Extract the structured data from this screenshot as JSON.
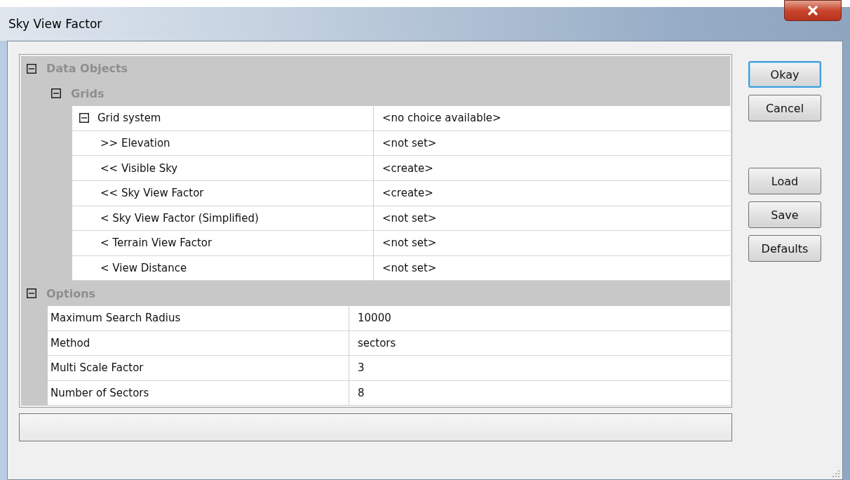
{
  "window": {
    "title": "Sky View Factor"
  },
  "properties": [
    {
      "kind": "category",
      "label": "Data Objects",
      "expanded": true,
      "children": [
        {
          "kind": "category",
          "label": "Grids",
          "expanded": true,
          "children": [
            {
              "kind": "property",
              "label": "Grid system",
              "value": "<no choice available>",
              "expanded": true,
              "children": [
                {
                  "kind": "property",
                  "label": ">> Elevation",
                  "value": "<not set>"
                },
                {
                  "kind": "property",
                  "label": "<< Visible Sky",
                  "value": "<create>"
                },
                {
                  "kind": "property",
                  "label": "<< Sky View Factor",
                  "value": "<create>"
                },
                {
                  "kind": "property",
                  "label": "< Sky View Factor (Simplified)",
                  "value": "<not set>"
                },
                {
                  "kind": "property",
                  "label": "< Terrain View Factor",
                  "value": "<not set>"
                },
                {
                  "kind": "property",
                  "label": "< View Distance",
                  "value": "<not set>"
                }
              ]
            }
          ]
        }
      ]
    },
    {
      "kind": "category",
      "label": "Options",
      "expanded": true,
      "children": [
        {
          "kind": "property",
          "label": "Maximum Search Radius",
          "value": "10000"
        },
        {
          "kind": "property",
          "label": "Method",
          "value": "sectors"
        },
        {
          "kind": "property",
          "label": "Multi Scale Factor",
          "value": "3"
        },
        {
          "kind": "property",
          "label": "Number of Sectors",
          "value": "8"
        }
      ]
    }
  ],
  "button_groups": [
    [
      {
        "label": "Okay",
        "focused": true
      },
      {
        "label": "Cancel",
        "focused": false
      }
    ],
    [
      {
        "label": "Load",
        "focused": false
      },
      {
        "label": "Save",
        "focused": false
      },
      {
        "label": "Defaults",
        "focused": false
      }
    ]
  ]
}
